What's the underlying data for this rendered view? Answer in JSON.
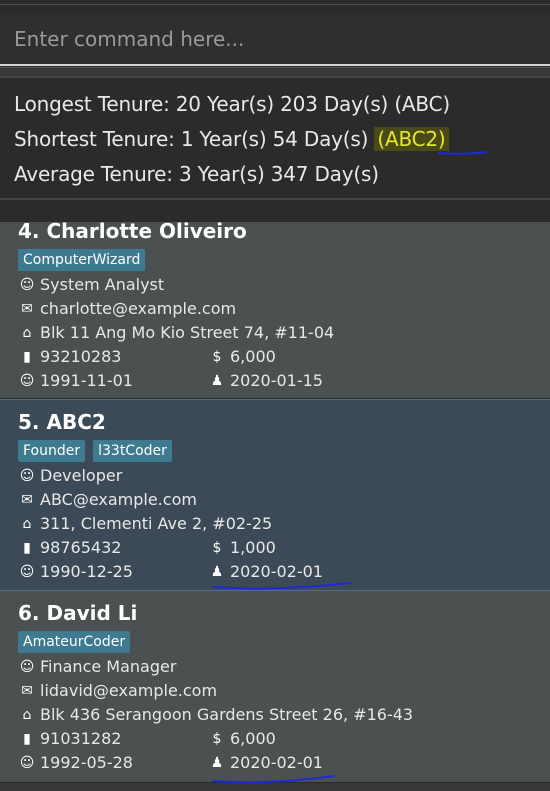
{
  "command_box": {
    "placeholder": "Enter command here..."
  },
  "result": {
    "longest": "Longest Tenure: 20 Year(s) 203 Day(s) (ABC)",
    "shortest_prefix": "Shortest Tenure: 1 Year(s) 54 Day(s) ",
    "shortest_highlight": "(ABC2)",
    "average": "Average Tenure: 3 Year(s) 347 Day(s)"
  },
  "persons": [
    {
      "index_name": "4.  Charlotte Oliveiro",
      "tags": [
        "ComputerWizard"
      ],
      "role": "System Analyst",
      "email": "charlotte@example.com",
      "address": "Blk 11 Ang Mo Kio Street 74, #11-04",
      "phone": "93210283",
      "salary": "6,000",
      "birthday": "1991-11-01",
      "join_date": "2020-01-15"
    },
    {
      "index_name": "5.  ABC2",
      "tags": [
        "Founder",
        "l33tCoder"
      ],
      "role": "Developer",
      "email": "ABC@example.com",
      "address": "311, Clementi Ave 2, #02-25",
      "phone": "98765432",
      "salary": "1,000",
      "birthday": "1990-12-25",
      "join_date": "2020-02-01"
    },
    {
      "index_name": "6.  David Li",
      "tags": [
        "AmateurCoder"
      ],
      "role": "Finance Manager",
      "email": "lidavid@example.com",
      "address": "Blk 436 Serangoon Gardens Street 26, #16-43",
      "phone": "91031282",
      "salary": "6,000",
      "birthday": "1992-05-28",
      "join_date": "2020-02-01"
    }
  ],
  "icons": {
    "role": "worker-face-icon",
    "email": "envelope-icon",
    "address": "home-icon",
    "phone": "phone-icon",
    "salary": "dollar-icon",
    "birthday": "baby-face-icon",
    "join_date": "user-tie-icon"
  },
  "colors": {
    "tag_bg": "#3e7b91",
    "selected_card_bg": "#3c4a57",
    "card_bg": "#4b5050",
    "highlight_text": "#e6e62a",
    "annotation_ink": "#1a2bd4"
  }
}
